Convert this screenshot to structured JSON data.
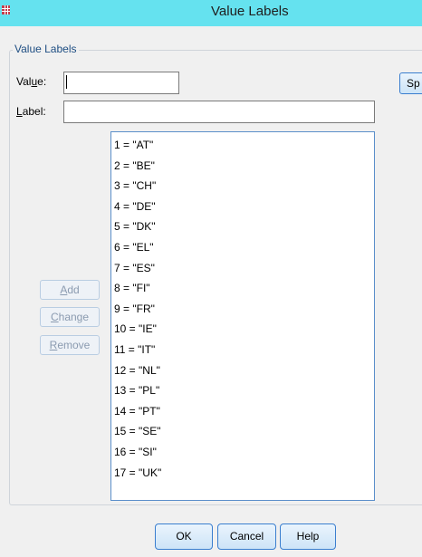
{
  "window": {
    "title": "Value Labels"
  },
  "group": {
    "legend": "Value Labels"
  },
  "value_field": {
    "label_pre": "Val",
    "label_mnemonic": "u",
    "label_post": "e:",
    "value": ""
  },
  "label_field": {
    "label_mnemonic": "L",
    "label_post": "abel:",
    "value": ""
  },
  "spelling_button": {
    "label": "Sp"
  },
  "buttons": {
    "add": {
      "mnemonic": "A",
      "rest": "dd"
    },
    "change": {
      "mnemonic": "C",
      "rest": "hange"
    },
    "remove": {
      "mnemonic": "R",
      "rest": "emove"
    }
  },
  "value_labels": [
    "1 = \"AT\"",
    "2 = \"BE\"",
    "3 = \"CH\"",
    "4 = \"DE\"",
    "5 = \"DK\"",
    "6 = \"EL\"",
    "7 = \"ES\"",
    "8 = \"FI\"",
    "9 = \"FR\"",
    "10 = \"IE\"",
    "11 = \"IT\"",
    "12 = \"NL\"",
    "13 = \"PL\"",
    "14 = \"PT\"",
    "15 = \"SE\"",
    "16 = \"SI\"",
    "17 = \"UK\""
  ],
  "footer": {
    "ok": "OK",
    "cancel": "Cancel",
    "help": "Help"
  },
  "icons": {
    "app": "spss-data-grid-icon"
  },
  "colors": {
    "titlebar": "#65e2ef",
    "legend_text": "#1d4d82",
    "button_border": "#3a7ecf",
    "disabled_text": "#8b9bb0"
  }
}
